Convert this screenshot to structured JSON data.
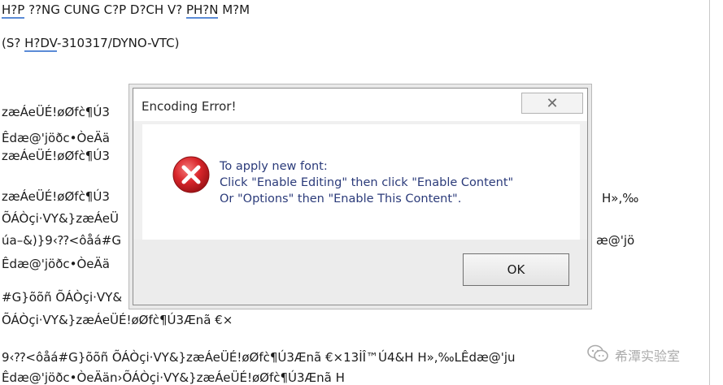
{
  "document": {
    "lines": [
      "H?P ??NG CUNG C?P D?CH V? PH?N M?M",
      "(S? H?DV-310317/DYNO-VTC)",
      "zæÁeÜÉ!øØfc̀¶Ú3",
      "Êdæ@'jöðc•ÒeÄä",
      "zæÁeÜÉ!øØfc̀¶Ú3",
      "zæÁeÜÉ!øØfc̀¶Ú3",
      "ÕÁÒçi·VY&}zæÁeÜ",
      "úa–&)}9‹⁇<ôåá#G",
      "Êdæ@'jöðc•ÒeÄä",
      "#G}õõñ ÕÁÒçi·VY&",
      "ÕÁÒçi·VY&}zæÁeÜÉ!øØfc̀¶Ú3Ænã €×",
      "9‹⁇<ôåá#G}õõñ ÕÁÒçi·VY&}zæÁeÜÉ!øØfc̀¶Ú3Ænã €×13İÎ™Ú4&H H»,‰LÊdæ@'ju",
      "Êdæ@'jöðc•ÒeÄän›ÕÁÒçi·VY&}zæÁeÜÉ!øØfc̀¶Ú3Ænã H"
    ],
    "right_fragments": [
      "H»,‰",
      "æ@'jö"
    ]
  },
  "dialog": {
    "title": "Encoding Error!",
    "close_symbol": "✕",
    "message_lines": [
      "To apply new font:",
      "Click \"Enable Editing\" then click \"Enable Content\"",
      "Or \"Options\" then \"Enable This Content\"."
    ],
    "ok_label": "OK",
    "icon": "error-icon"
  },
  "watermark": {
    "text": "希潭实验室",
    "icon": "wechat-icon"
  },
  "colors": {
    "error_red": "#d9262b",
    "message_text": "#2b3b7a",
    "link_underline": "#5b8bd6"
  }
}
